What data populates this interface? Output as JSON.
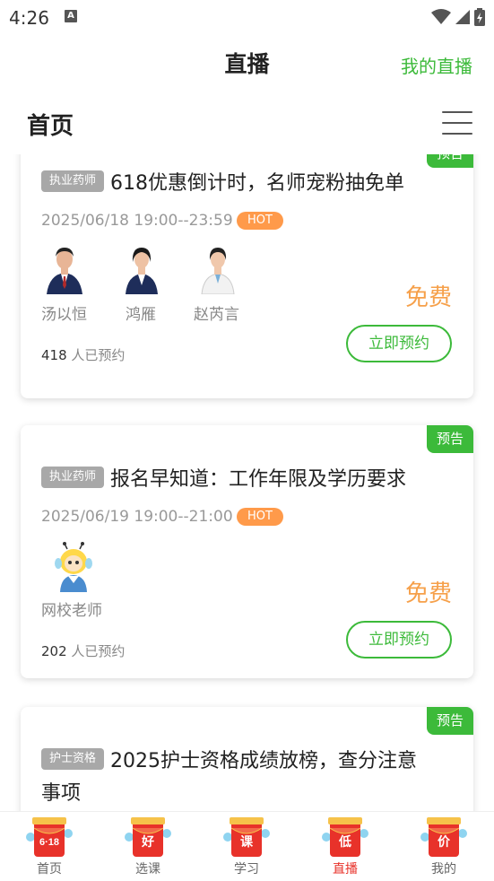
{
  "status_bar": {
    "time": "4:26",
    "a_icon_letter": "A"
  },
  "header": {
    "title": "直播",
    "my_live": "我的直播"
  },
  "section": {
    "title": "首页"
  },
  "cards": [
    {
      "badge": "预告",
      "category": "执业药师",
      "title": "618优惠倒计时，名师宠粉抽免单",
      "time": "2025/06/18 19:00--23:59",
      "hot": "HOT",
      "teachers": [
        "汤以恒",
        "鸿雁",
        "赵芮言"
      ],
      "price": "免费",
      "booked_count": "418",
      "booked_suffix": " 人已预约",
      "button": "立即预约"
    },
    {
      "badge": "预告",
      "category": "执业药师",
      "title": "报名早知道：工作年限及学历要求",
      "time": "2025/06/19 19:00--21:00",
      "hot": "HOT",
      "teachers": [
        "网校老师"
      ],
      "price": "免费",
      "booked_count": "202",
      "booked_suffix": " 人已预约",
      "button": "立即预约"
    },
    {
      "badge": "预告",
      "category": "护士资格",
      "title_line1": "2025护士资格成绩放榜，查分注意",
      "title_line2": "事项"
    }
  ],
  "bottom_nav": [
    {
      "label": "首页",
      "icon_text": "6·18",
      "active": false
    },
    {
      "label": "选课",
      "icon_text": "好",
      "active": false
    },
    {
      "label": "学习",
      "icon_text": "课",
      "active": false
    },
    {
      "label": "直播",
      "icon_text": "低",
      "active": true
    },
    {
      "label": "我的",
      "icon_text": "价",
      "active": false
    }
  ],
  "colors": {
    "accent_green": "#3cba3a",
    "price_orange": "#f6a04a",
    "hot_orange": "#ff9a4a",
    "active_red": "#e8322a"
  }
}
